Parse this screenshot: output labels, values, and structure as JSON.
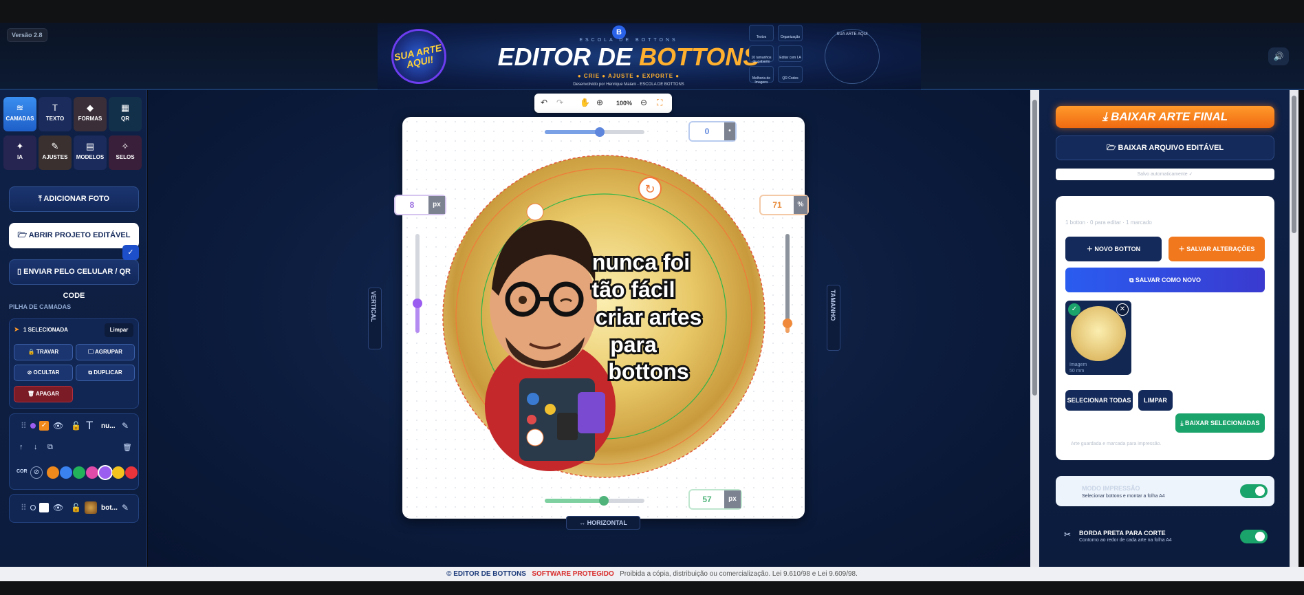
{
  "header": {
    "version": "Versão 2.8",
    "banner": {
      "subtitle": "ESCOLA DE BOTTONS",
      "title_part1": "EDITOR DE ",
      "title_part2": "BOTTONS",
      "tags": "● CRIE   ● AJUSTE   ● EXPORTE ●",
      "credit": "Desenvolvido por Henrique Maiani - ESCOLA DE BOTTONS",
      "badge_text": "SUA ARTE AQUI!",
      "logo_letter": "B",
      "menu_items": [
        "Textos",
        "Organização",
        "10 tamanhos de gabarito",
        "Editar com I.A",
        "Melhoria de Imagens",
        "QR Codes"
      ],
      "circle_label": "SUA ARTE AQUI"
    }
  },
  "tools": [
    {
      "label": "CAMADAS",
      "icon": "≋",
      "color": "#2f7de0"
    },
    {
      "label": "TEXTO",
      "icon": "T",
      "color": "#1a2b5c"
    },
    {
      "label": "FORMAS",
      "icon": "◆",
      "color": "#3a2a3a"
    },
    {
      "label": "QR",
      "icon": "▦",
      "color": "#12304a"
    },
    {
      "label": "IA",
      "icon": "✦",
      "color": "#2a2450"
    },
    {
      "label": "AJUSTES",
      "icon": "✎",
      "color": "#3a3030"
    },
    {
      "label": "MODELOS",
      "icon": "▤",
      "color": "#1a2b5c"
    },
    {
      "label": "SELOS",
      "icon": "✧",
      "color": "#3a1f3a"
    }
  ],
  "sidebar": {
    "add_photo": "ADICIONAR FOTO",
    "open_project": "ABRIR PROJETO EDITÁVEL",
    "send_phone": "ENVIAR PELO CELULAR / QR CODE",
    "layer_stack": "PILHA DE CAMADAS",
    "selected": "1 SELECIONADA",
    "clear": "Limpar",
    "lock": "TRAVAR",
    "group": "AGRUPAR",
    "hide": "OCULTAR",
    "duplicate": "DUPLICAR",
    "delete": "APAGAR",
    "color_label": "COR",
    "layer1_name": "nu...",
    "layer2_name": "bot...",
    "colors": [
      "#f08a1c",
      "#3a82f0",
      "#22b35a",
      "#e04aa8",
      "#9b5cf0",
      "#f2c21e",
      "#e8343a"
    ]
  },
  "canvas": {
    "zoom": "100%",
    "top_value": "0",
    "left_value": "8",
    "left_unit": "px",
    "right_value": "71",
    "right_unit": "%",
    "bottom_value": "57",
    "bottom_unit": "px",
    "vertical_label": "VERTICAL",
    "size_label": "TAMANHO",
    "horizontal_label": "HORIZONTAL",
    "button_text": [
      "nunca foi",
      "tão fácil",
      "criar artes",
      "para",
      "bottons"
    ],
    "top_slider_pct": 55,
    "bottom_slider_pct": 59,
    "left_slider_pct": 30,
    "right_slider_pct": 10
  },
  "right": {
    "download_final": "BAIXAR ARTE FINAL",
    "download_editable": "BAIXAR ARQUIVO EDITÁVEL",
    "autosave": "Salvo automaticamente ✓",
    "count_line": "1 botton · 0 para editar · 1 marcado",
    "new_button": "NOVO BOTTON",
    "save_changes": "SALVAR ALTERAÇÕES",
    "save_as_new": "SALVAR COMO NOVO",
    "thumb_label": "Imagem",
    "thumb_size": "50 mm",
    "select_all": "SELECIONAR TODAS",
    "clear": "LIMPAR",
    "download_selected": "BAIXAR SELECIONADAS",
    "note": "Arte guardada e marcada para impressão.",
    "print_mode_title": "MODO IMPRESSÃO",
    "print_mode_desc": "Selecionar bottons e montar a folha A4",
    "border_title": "BORDA PRETA PARA CORTE",
    "border_desc": "Contorno ao redor de cada arte na folha A4"
  },
  "footer": {
    "brand": "© EDITOR DE BOTTONS",
    "protected": "SOFTWARE PROTEGIDO",
    "notice": "Proibida a cópia, distribuição ou comercialização. Lei 9.610/98 e Lei 9.609/98."
  }
}
